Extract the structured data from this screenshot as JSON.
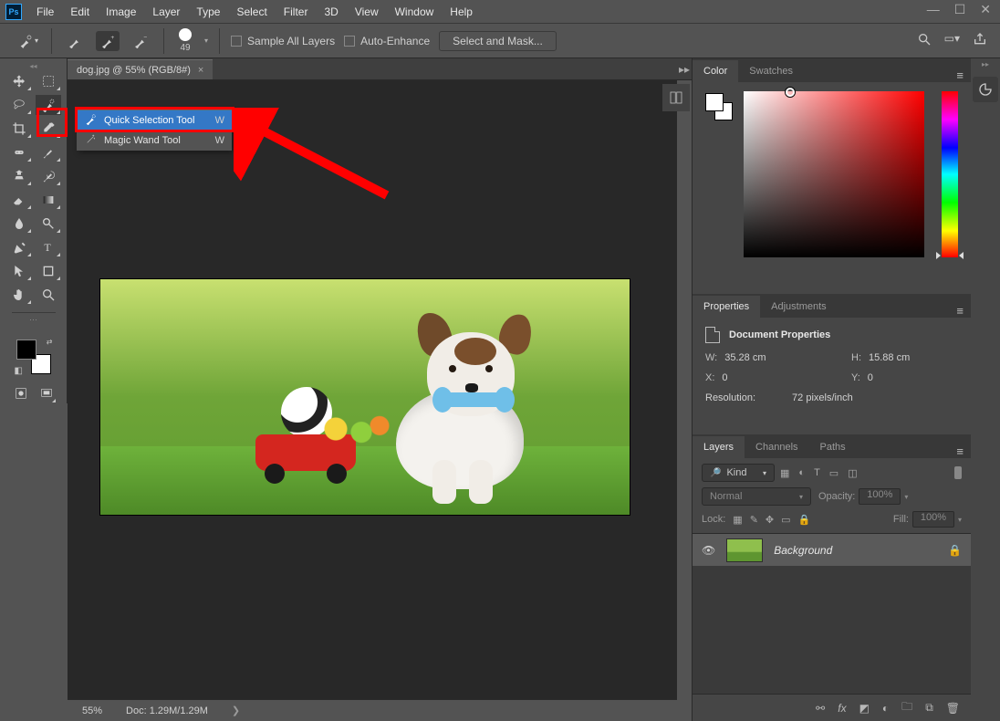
{
  "menubar": {
    "items": [
      "File",
      "Edit",
      "Image",
      "Layer",
      "Type",
      "Select",
      "Filter",
      "3D",
      "View",
      "Window",
      "Help"
    ]
  },
  "options": {
    "brush_size": "49",
    "sample_all_layers": "Sample All Layers",
    "auto_enhance": "Auto-Enhance",
    "select_and_mask": "Select and Mask..."
  },
  "document": {
    "tab_title": "dog.jpg @ 55% (RGB/8#)",
    "zoom": "55%",
    "doc_size": "Doc: 1.29M/1.29M"
  },
  "flyout": {
    "items": [
      {
        "label": "Quick Selection Tool",
        "shortcut": "W",
        "selected": true
      },
      {
        "label": "Magic Wand Tool",
        "shortcut": "W",
        "selected": false
      }
    ]
  },
  "panels": {
    "color": {
      "tab_color": "Color",
      "tab_swatches": "Swatches"
    },
    "properties": {
      "tab_properties": "Properties",
      "tab_adjustments": "Adjustments",
      "title": "Document Properties",
      "w_label": "W:",
      "w_value": "35.28 cm",
      "h_label": "H:",
      "h_value": "15.88 cm",
      "x_label": "X:",
      "x_value": "0",
      "y_label": "Y:",
      "y_value": "0",
      "resolution_label": "Resolution:",
      "resolution_value": "72 pixels/inch"
    },
    "layers": {
      "tab_layers": "Layers",
      "tab_channels": "Channels",
      "tab_paths": "Paths",
      "kind_label": "Kind",
      "blend_mode": "Normal",
      "opacity_label": "Opacity:",
      "opacity_value": "100%",
      "lock_label": "Lock:",
      "fill_label": "Fill:",
      "fill_value": "100%",
      "rows": [
        {
          "name": "Background"
        }
      ]
    }
  },
  "search_placeholder": "Kind"
}
